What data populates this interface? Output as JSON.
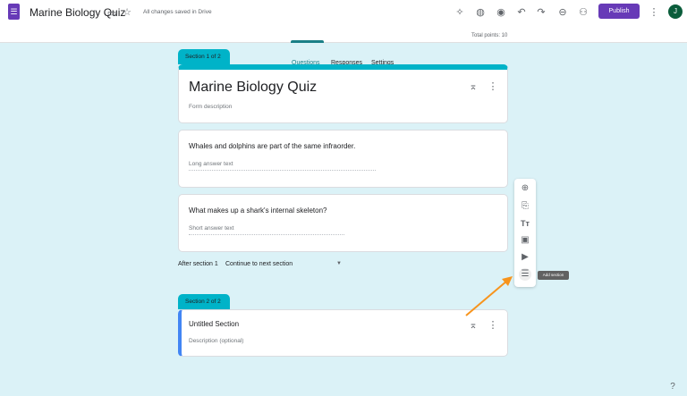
{
  "header": {
    "title": "Marine Biology Quiz",
    "saved": "All changes saved in Drive",
    "publish": "Publish",
    "avatar": "J"
  },
  "tabs": [
    "Questions",
    "Responses",
    "Settings"
  ],
  "total_points": "Total points: 10",
  "section1": {
    "label": "Section 1 of 2",
    "title": "Marine Biology Quiz",
    "description": "Form description"
  },
  "questions": [
    {
      "text": "Whales and dolphins are part of the same infraorder.",
      "answer": "Long answer text"
    },
    {
      "text": "What makes up a shark's internal skeleton?",
      "answer": "Short answer text"
    }
  ],
  "after": {
    "label": "After section 1",
    "value": "Continue to next section"
  },
  "section2": {
    "label": "Section 2 of 2",
    "title": "Untitled Section",
    "description": "Description (optional)"
  },
  "tooltip": "Add section",
  "colors": {
    "accent": "#673ab7",
    "teal": "#00b3c8",
    "arrow": "#f7941d"
  }
}
